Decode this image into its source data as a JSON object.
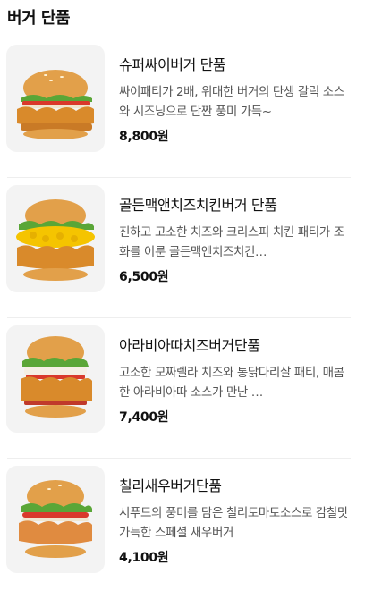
{
  "section": {
    "title": "버거 단품"
  },
  "items": [
    {
      "name": "슈퍼싸이버거 단품",
      "description": "싸이패티가 2배, 위대한 버거의 탄생 갈릭 소스와 시즈닝으로 단짠 풍미 가득~",
      "price": "8,800원",
      "image_icon": "burger-image"
    },
    {
      "name": "골든맥앤치즈치킨버거 단품",
      "description": "진하고 고소한 치즈와 크리스피 치킨 패티가 조화를 이룬 골든맥앤치즈치킨…",
      "price": "6,500원",
      "image_icon": "burger-image"
    },
    {
      "name": "아라비아따치즈버거단품",
      "description": "고소한 모짜렐라 치즈와 통닭다리살 패티, 매콤한 아라비아따 소스가 만난 …",
      "price": "7,400원",
      "image_icon": "burger-image"
    },
    {
      "name": "칠리새우버거단품",
      "description": "시푸드의 풍미를 담은 칠리토마토소스로 감칠맛 가득한 스페셜 새우버거",
      "price": "4,100원",
      "image_icon": "burger-image"
    }
  ],
  "colors": {
    "bun": "#e2a04a",
    "lettuce": "#5aa637",
    "tomato": "#d9392b",
    "patty": "#d98a2b",
    "cheese": "#f5c400",
    "sauce": "#f1e6cf",
    "thumb_bg": "#f3f3f3"
  }
}
